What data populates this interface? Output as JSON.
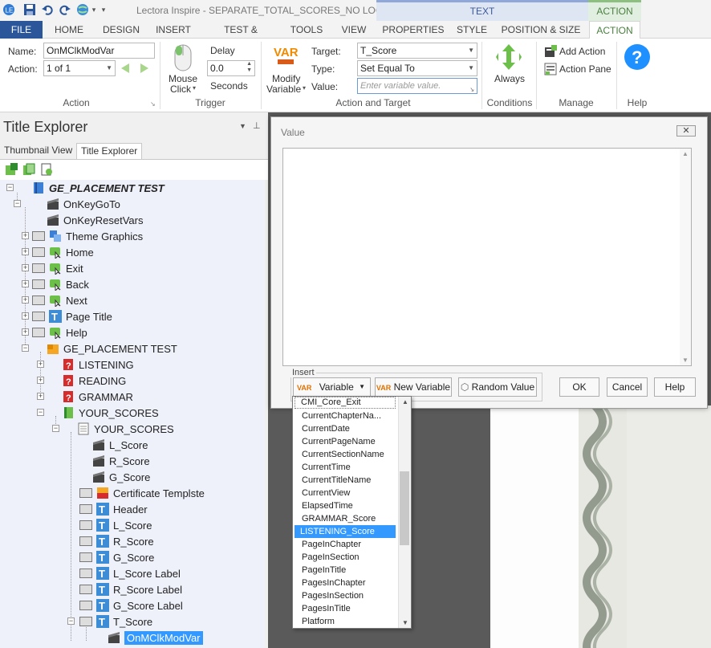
{
  "titlebar": {
    "window_title": "Lectora Inspire - SEPARATE_TOTAL_SCORES_NO LOGIN",
    "context_text": "TEXT",
    "context_action": "ACTION",
    "qa_dropdown": "▾"
  },
  "tabs": {
    "file": "FILE",
    "home": "HOME",
    "design": "DESIGN",
    "insert": "INSERT",
    "test_survey": "TEST & SURVEY",
    "tools": "TOOLS",
    "view": "VIEW",
    "properties": "PROPERTIES",
    "style": "STYLE",
    "position_size": "POSITION & SIZE",
    "action": "ACTION"
  },
  "ribbon": {
    "name_label": "Name:",
    "name_value": "OnMClkModVar",
    "action_label": "Action:",
    "action_value": "1 of 1",
    "group_action": "Action",
    "mouse_click_line1": "Mouse",
    "mouse_click_line2": "Click",
    "delay_label": "Delay",
    "delay_value": "0.0",
    "seconds_label": "Seconds",
    "group_trigger": "Trigger",
    "var_badge": "VAR",
    "modify_variable_line1": "Modify",
    "modify_variable_line2": "Variable",
    "target_label": "Target:",
    "target_value": "T_Score",
    "type_label": "Type:",
    "type_value": "Set Equal To",
    "value_label": "Value:",
    "value_placeholder": "Enter variable value.",
    "group_action_target": "Action and Target",
    "always_label": "Always",
    "group_conditions": "Conditions",
    "add_action": "Add Action",
    "action_pane": "Action Pane",
    "group_manage": "Manage",
    "group_help": "Help"
  },
  "leftpane": {
    "title": "Title Explorer",
    "tab_thumbnail": "Thumbnail View",
    "tab_explorer": "Title Explorer"
  },
  "tree": {
    "root": "GE_PLACEMENT TEST",
    "onkeygoto": "OnKeyGoTo",
    "onkeyresetvars": "OnKeyResetVars",
    "theme_graphics": "Theme Graphics",
    "home": "Home",
    "exit": "Exit",
    "back": "Back",
    "next": "Next",
    "page_title": "Page Title",
    "help": "Help",
    "chapter": "GE_PLACEMENT TEST",
    "listening": "LISTENING",
    "reading": "READING",
    "grammar": "GRAMMAR",
    "your_scores_section": "YOUR_SCORES",
    "your_scores_page": "YOUR_SCORES",
    "l_score_action": "L_Score",
    "r_score_action": "R_Score",
    "g_score_action": "G_Score",
    "certificate": "Certificate Templste",
    "header": "Header",
    "l_score_text": "L_Score",
    "r_score_text": "R_Score",
    "g_score_text": "G_Score",
    "l_score_label": "L_Score Label",
    "r_score_label": "R_Score Label",
    "g_score_label": "G_Score Label",
    "t_score": "T_Score",
    "onmclkmodvar": "OnMClkModVar"
  },
  "dialog": {
    "title": "Value",
    "close": "✕",
    "insert_label": "Insert",
    "variable_btn": "Variable",
    "new_variable_btn": "New Variable",
    "random_value_btn": "Random Value",
    "ok_btn": "OK",
    "cancel_btn": "Cancel",
    "help_btn": "Help"
  },
  "varlist": {
    "items": [
      "CMI_Core_Exit",
      "CurrentChapterNa...",
      "CurrentDate",
      "CurrentPageName",
      "CurrentSectionName",
      "CurrentTime",
      "CurrentTitleName",
      "CurrentView",
      "ElapsedTime",
      "GRAMMAR_Score",
      "LISTENING_Score",
      "PageInChapter",
      "PageInSection",
      "PageInTitle",
      "PagesInChapter",
      "PagesInSection",
      "PagesInTitle",
      "Platform"
    ],
    "selected": "LISTENING_Score"
  },
  "colors": {
    "file_tab": "#2b579a",
    "action_accent": "#4a7f3f",
    "selection": "#3399ff",
    "workspace": "#5a5a5a"
  }
}
